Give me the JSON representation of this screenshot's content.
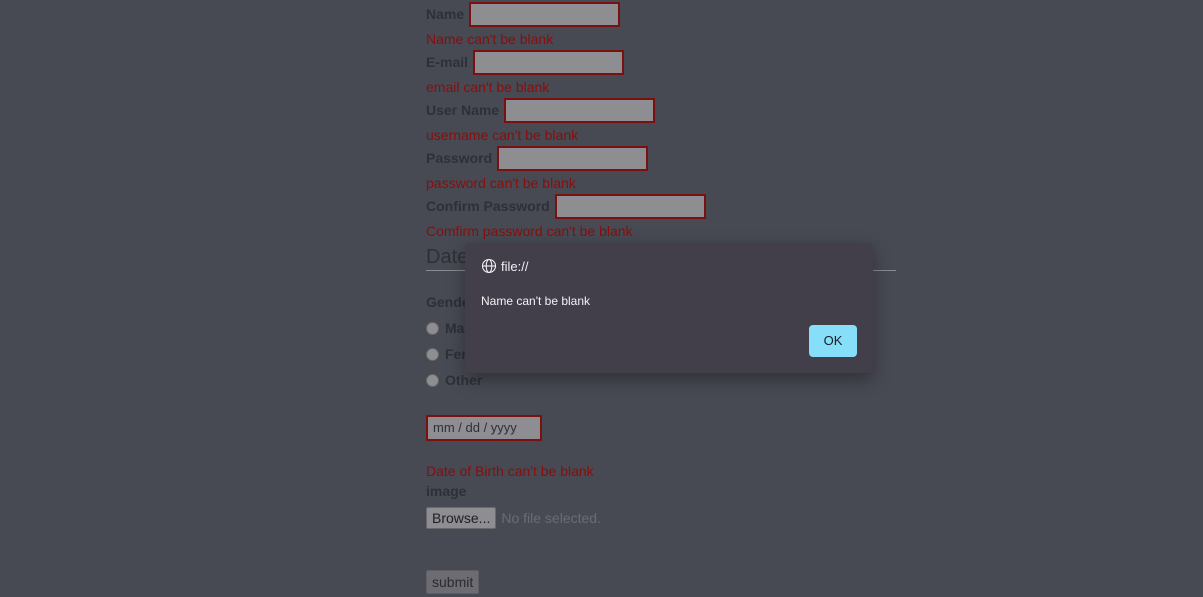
{
  "form": {
    "fields": [
      {
        "label": "Name",
        "error": "Name can't be blank"
      },
      {
        "label": "E-mail",
        "error": "email can't be blank"
      },
      {
        "label": "User Name",
        "error": "username can't be blank"
      },
      {
        "label": "Password",
        "error": "password can't be blank"
      },
      {
        "label": "Confirm Password",
        "error": "Comfirm password can't be blank"
      }
    ],
    "legend": "Date",
    "gender_label": "Gender",
    "gender_options": [
      "Male",
      "Female",
      "Other"
    ],
    "date_placeholder": "mm / dd / yyyy",
    "dob_error": "Date of Birth can't be blank",
    "image_label": "image",
    "browse_label": "Browse...",
    "no_file_text": "No file selected.",
    "submit_label": "submit"
  },
  "dialog": {
    "origin": "file://",
    "message": "Name can't be blank",
    "ok_label": "OK"
  },
  "colors": {
    "background": "#474a53",
    "error_text": "#8a0d0d",
    "input_border": "#7b1010",
    "dialog_bg": "#423f4b",
    "ok_button": "#86def8"
  }
}
